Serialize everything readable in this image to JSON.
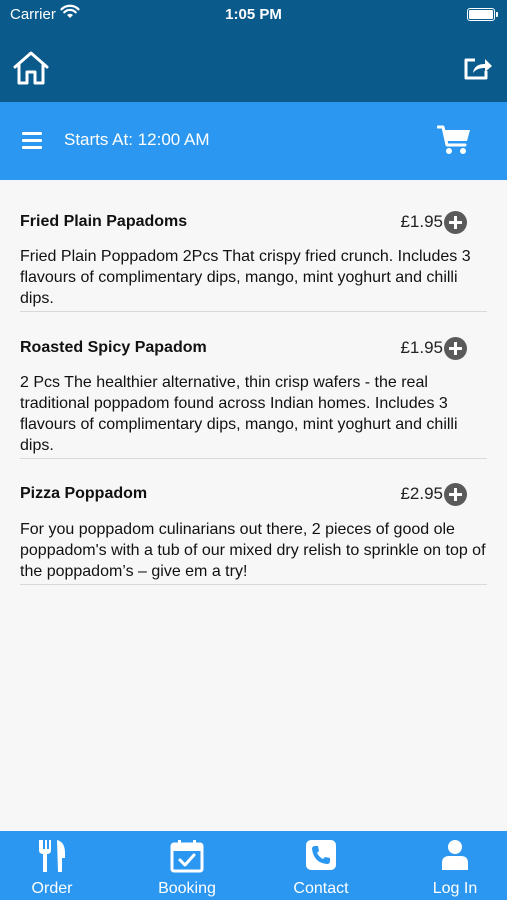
{
  "status_bar": {
    "carrier": "Carrier",
    "time": "1:05 PM"
  },
  "header": {
    "home_icon": "home-icon",
    "share_icon": "share-icon"
  },
  "subheader": {
    "starts_at": "Starts At: 12:00 AM",
    "menu_icon": "hamburger-menu-icon",
    "cart_icon": "cart-icon"
  },
  "items": [
    {
      "name": "Fried Plain Papadoms",
      "price": "£1.95",
      "description": "Fried Plain Poppadom 2Pcs That crispy fried crunch. Includes 3 flavours of complimentary dips, mango, mint yoghurt and chilli dips."
    },
    {
      "name": "Roasted Spicy Papadom",
      "price": "£1.95",
      "description": "2 Pcs The healthier alternative, thin crisp wafers - the real traditional poppadom found across Indian homes. Includes 3 flavours of complimentary dips, mango, mint yoghurt and chilli dips."
    },
    {
      "name": "Pizza Poppadom",
      "price": "£2.95",
      "description": "For you poppadom culinarians out there, 2 pieces of good ole poppadom's with a tub of our mixed dry relish to sprinkle on top of the poppadom’s – give em a try!"
    }
  ],
  "tabs": [
    {
      "label": "Order",
      "icon": "cutlery-icon"
    },
    {
      "label": "Booking",
      "icon": "calendar-icon"
    },
    {
      "label": "Contact",
      "icon": "phone-icon"
    },
    {
      "label": "Log In",
      "icon": "user-icon"
    }
  ],
  "colors": {
    "header": "#0a5a8c",
    "accent": "#2b97f0",
    "background": "#f7f7f7"
  }
}
